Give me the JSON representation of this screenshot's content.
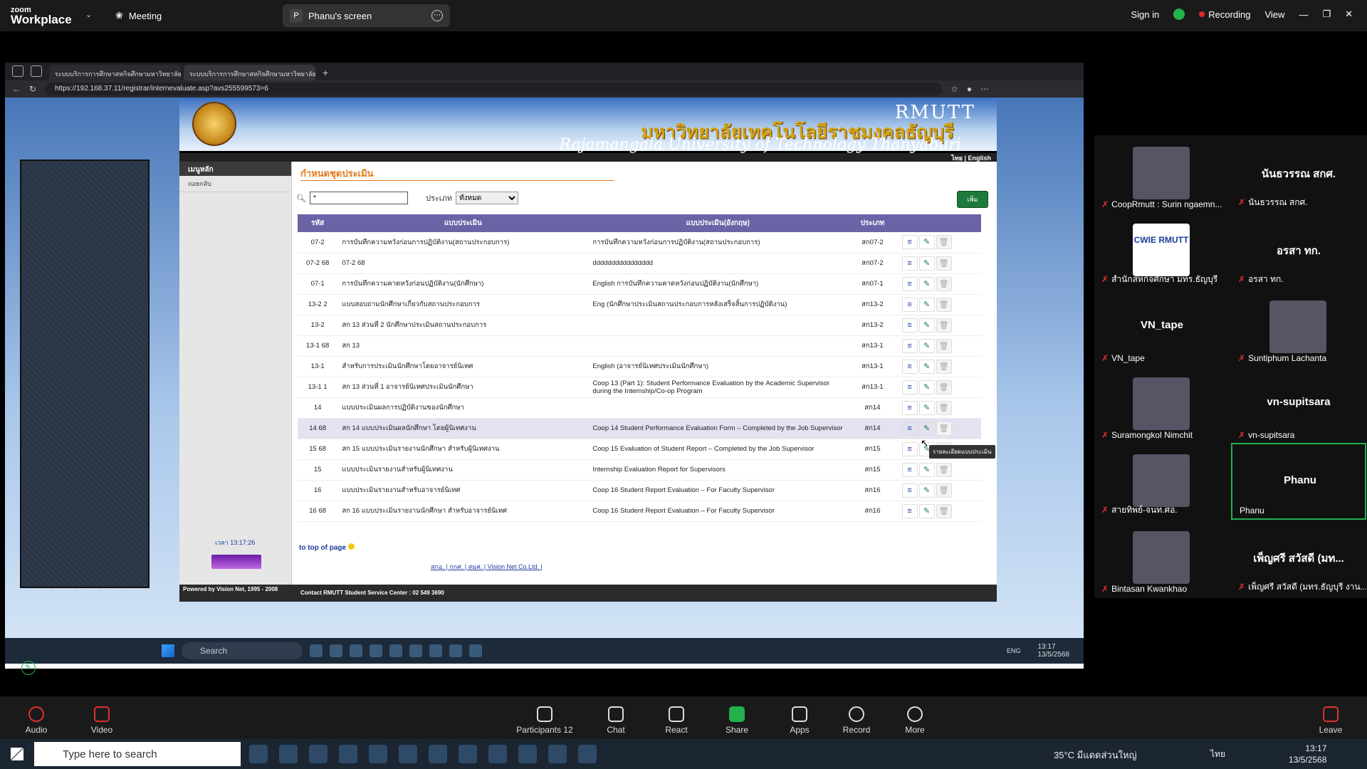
{
  "zoom": {
    "logo_line1": "zoom",
    "logo_line2": "Workplace",
    "meeting_label": "Meeting",
    "share_initial": "P",
    "share_label": "Phanu's screen",
    "signin": "Sign in",
    "recording": "Recording",
    "view": "View"
  },
  "browser": {
    "tabs": [
      "ระบบบริการการศึกษาสหกิจศึกษามหาวิทยาลัยราชม",
      "ระบบบริการการศึกษาสหกิจศึกษามหาวิทยาลัยราชม"
    ],
    "url": "https://192.168.37.11/registrar/internevaluate.asp?avs255599573=6"
  },
  "site": {
    "brand": "RMUTT",
    "thai_name": "มหาวิทยาลัยเทคโนโลยีราชมงคลธัญบุรี",
    "english_name": "Rajamangala University of Technology Thanyaburi",
    "lang": "ไทย | English",
    "side_header": "เมนูหลัก",
    "side_item": "ถอยกลับ",
    "time": "เวลา 13:17:26",
    "page_title": "กำหนดชุดประเมิน",
    "search_value": "*",
    "type_label": "ประเภท",
    "type_value": "ทั้งหมด",
    "add_button": "เพิ่ม",
    "columns": [
      "รหัส",
      "แบบประเมิน",
      "แบบประเมิน(อังกฤษ)",
      "ประเภท"
    ],
    "rows": [
      {
        "code": "07-2",
        "name": "การบันทึกความหวังก่อนการปฏิบัติงาน(สถานประกอบการ)",
        "name_en": "การบันทึกความหวังก่อนการปฏิบัติงาน(สถานประกอบการ)",
        "type": "สก07-2"
      },
      {
        "code": "07-2 68",
        "name": "07-2 68",
        "name_en": "dddddddddddddddd",
        "type": "สก07-2"
      },
      {
        "code": "07-1",
        "name": "การบันทึกความคาดหวังก่อนปฏิบัติงาน(นักศึกษา)",
        "name_en": "English การบันทึกความคาดหวังก่อนปฏิบัติงาน(นักศึกษา)",
        "type": "สก07-1"
      },
      {
        "code": "13-2 2",
        "name": "แบบสอบถามนักศึกษาเกี่ยวกับสถานประกอบการ",
        "name_en": "Eng (นักศึกษาประเมินสถานประกอบการหลังเสร็จสิ้นการปฏิบัติงาน)",
        "type": "สก13-2"
      },
      {
        "code": "13-2",
        "name": "สก 13 ส่วนที่ 2 นักศึกษาประเมินสถานประกอบการ",
        "name_en": "",
        "type": "สก13-2"
      },
      {
        "code": "13-1 68",
        "name": "สก 13",
        "name_en": "",
        "type": "สก13-1"
      },
      {
        "code": "13-1",
        "name": "สำหรับการประเมินนักศึกษาโดยอาจารย์นิเทศ",
        "name_en": "English (อาจารย์นิเทศประเมินนักศึกษา)",
        "type": "สก13-1"
      },
      {
        "code": "13-1 1",
        "name": "สก 13 ส่วนที่ 1 อาจารย์นิเทศประเมินนักศึกษา",
        "name_en": "Coop 13 (Part 1): Student Performance Evaluation by the Academic Supervisor during the Internship/Co-op Program",
        "type": "สก13-1"
      },
      {
        "code": "14",
        "name": "แบบประเมินผลการปฏิบัติงานของนักศึกษา",
        "name_en": "",
        "type": "สก14"
      },
      {
        "code": "14 68",
        "name": "สก 14 แบบประเมินผลนักศึกษา โดยผู้นิเทศงาน",
        "name_en": "Coop 14 Student Performance Evaluation Form – Completed by the Job Supervisor",
        "type": "สก14"
      },
      {
        "code": "15 68",
        "name": "สก 15 แบบประเมินรายงานนักศึกษา สำหรับผู้นิเทศงาน",
        "name_en": "Coop 15 Evaluation of Student Report – Completed by the Job Supervisor",
        "type": "สก15"
      },
      {
        "code": "15",
        "name": "แบบประเมินรายงานสำหรับผู้นิเทศงาน",
        "name_en": "Internship Evaluation Report for Supervisors",
        "type": "สก15"
      },
      {
        "code": "16",
        "name": "แบบประเมินรายงานสำหรับอาจารย์นิเทศ",
        "name_en": "Coop 16 Student Report Evaluation – For Faculty Supervisor",
        "type": "สก16"
      },
      {
        "code": "16 68",
        "name": "สก 16 แบบประเมินรายงานนักศึกษา สำหรับอาจารย์นิเทศ",
        "name_en": "Coop 16 Student Report Evaluation – For Faculty Supervisor",
        "type": "สก16"
      }
    ],
    "tooltip": "รายละเอียดแบบประเมิน",
    "to_top": "to top of page",
    "footer_links": "สกอ. | กกศ. | สมศ. | Vision Net Co.Ltd. |",
    "powered": "Powered by Vision Net, 1995 - 2008",
    "contact": "Contact RMUTT Student Service Center : 02 549 3690"
  },
  "inner_taskbar": {
    "search": "Search",
    "lang": "ENG",
    "time": "13:17",
    "date": "13/5/2568"
  },
  "participants": [
    {
      "big": "",
      "name": "CoopRmutt : Surin ngaemn..."
    },
    {
      "big": "นันธวรรณ สกศ.",
      "name": "นันธวรรณ สกศ."
    },
    {
      "big": "",
      "name": "สำนักสหกิจศึกษา มทร.ธัญบุรี"
    },
    {
      "big": "อรสา ทก.",
      "name": "อรสา ทก."
    },
    {
      "big": "VN_tape",
      "name": "VN_tape"
    },
    {
      "big": "",
      "name": "Suntiphum Lachanta"
    },
    {
      "big": "",
      "name": "Suramongkol Nimchit"
    },
    {
      "big": "vn-supitsara",
      "name": "vn-supitsara"
    },
    {
      "big": "",
      "name": "สายทิพย์-จนท.ศอ."
    },
    {
      "big": "Phanu",
      "name": "Phanu"
    },
    {
      "big": "",
      "name": "Bintasan Kwankhao"
    },
    {
      "big": "เพ็ญศรี สวัสดี (มท...",
      "name": "เพ็ญศรี สวัสดี (มทร.ธัญบุรี งาน..."
    }
  ],
  "cwie_logo": "CWIE RMUTT",
  "controls": {
    "audio": "Audio",
    "video": "Video",
    "participants": "Participants",
    "participant_count": "12",
    "chat": "Chat",
    "react": "React",
    "share": "Share",
    "apps": "Apps",
    "record": "Record",
    "more": "More",
    "leave": "Leave"
  },
  "windows": {
    "search": "Type here to search",
    "weather": "35°C มีแดดส่วนใหญ่",
    "lang": "ไทย",
    "time": "13:17",
    "date": "13/5/2568"
  }
}
